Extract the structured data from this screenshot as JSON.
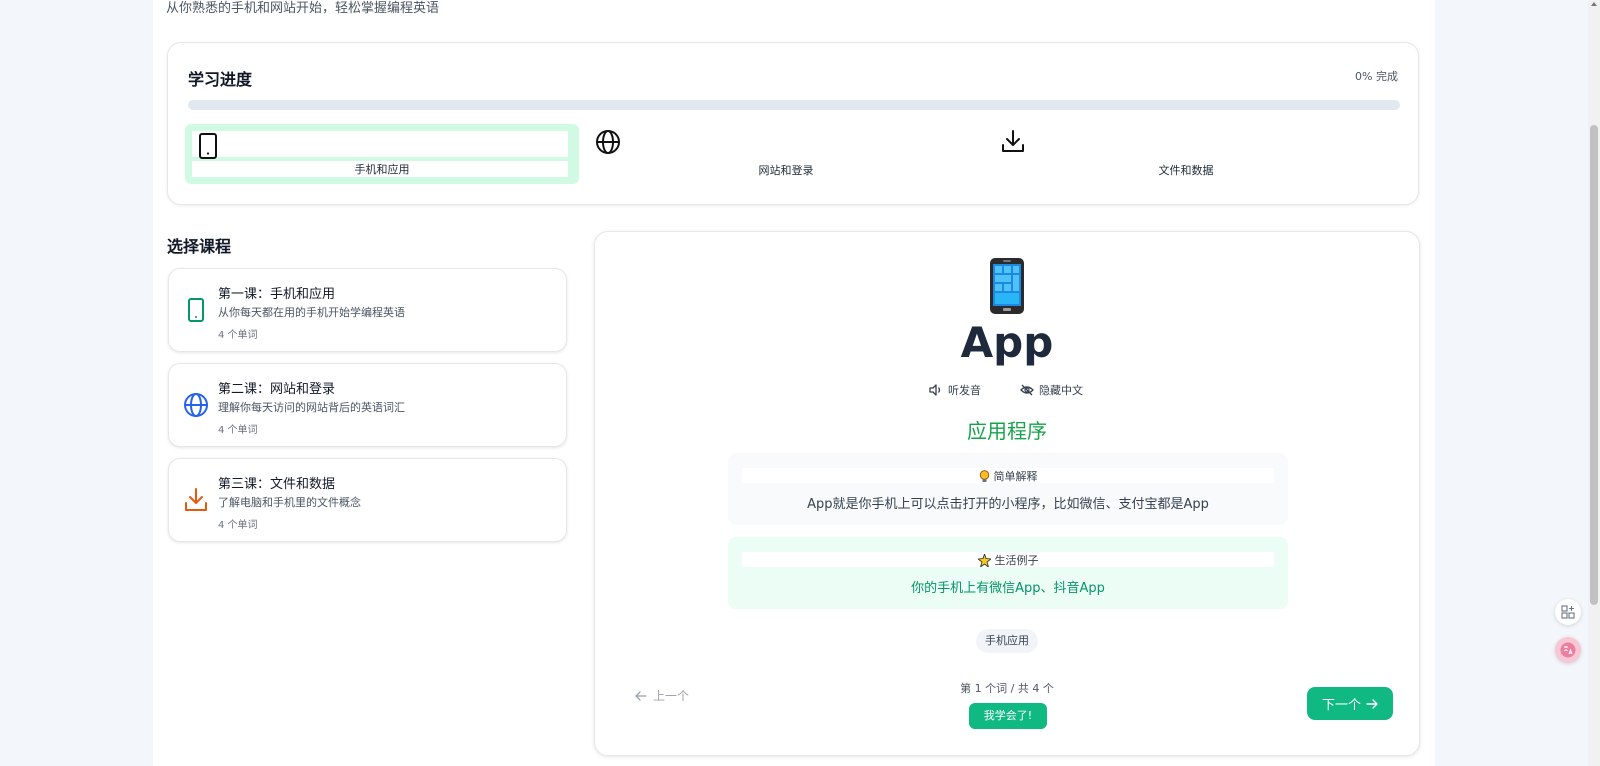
{
  "header": {
    "subtitle": "从你熟悉的手机和网站开始，轻松掌握编程英语"
  },
  "progress": {
    "title": "学习进度",
    "percent_text": "0% 完成",
    "percent": 0,
    "steps": [
      {
        "label": "手机和应用",
        "icon": "phone-icon",
        "active": true
      },
      {
        "label": "网站和登录",
        "icon": "globe-icon",
        "active": false
      },
      {
        "label": "文件和数据",
        "icon": "download-icon",
        "active": false
      }
    ]
  },
  "courses": {
    "title": "选择课程",
    "items": [
      {
        "title": "第一课：手机和应用",
        "desc": "从你每天都在用的手机开始学编程英语",
        "count": "4 个单词",
        "icon": "phone-icon",
        "color": "#059669"
      },
      {
        "title": "第二课：网站和登录",
        "desc": "理解你每天访问的网站背后的英语词汇",
        "count": "4 个单词",
        "icon": "globe-icon",
        "color": "#2563eb"
      },
      {
        "title": "第三课：文件和数据",
        "desc": "了解电脑和手机里的文件概念",
        "count": "4 个单词",
        "icon": "download-icon",
        "color": "#ea580c"
      }
    ]
  },
  "card": {
    "emoji": "mobile-phone-emoji",
    "word": "App",
    "listen_label": "听发音",
    "hide_label": "隐藏中文",
    "meaning": "应用程序",
    "explain_title": "简单解释",
    "explain_text": "App就是你手机上可以点击打开的小程序，比如微信、支付宝都是App",
    "example_title": "生活例子",
    "example_text": "你的手机上有微信App、抖音App",
    "tag": "手机应用",
    "prev_label": "上一个",
    "counter": "第 1 个词 / 共 4 个",
    "learned_label": "我学会了!",
    "next_label": "下一个"
  },
  "colors": {
    "accent": "#10b981",
    "meaning": "#16a34a",
    "progress_track": "#e2e8f0"
  }
}
